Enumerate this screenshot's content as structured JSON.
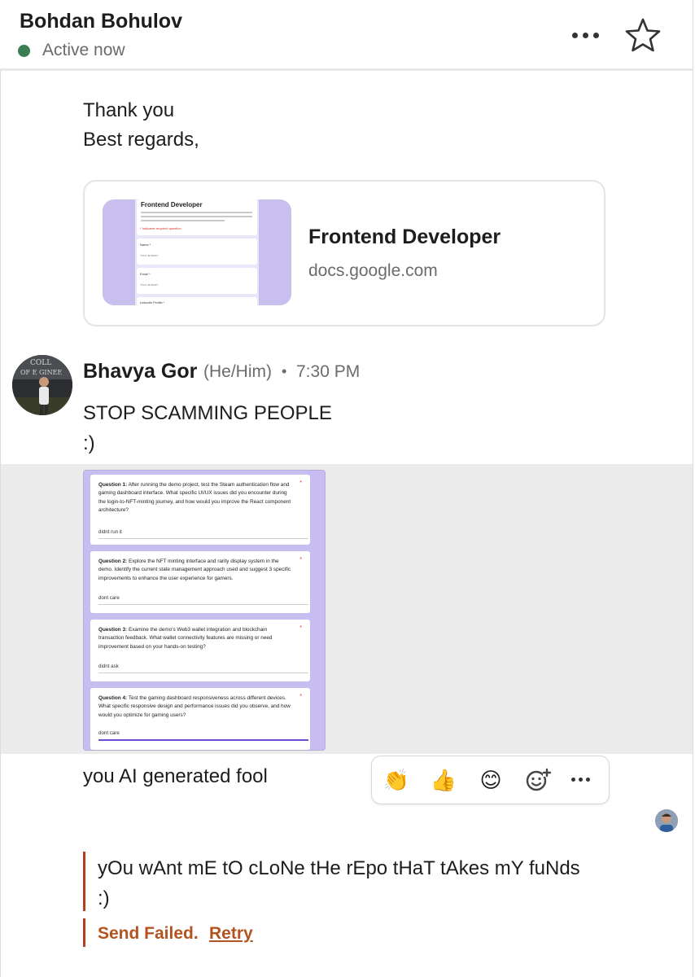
{
  "header": {
    "contact_name": "Bohdan Bohulov",
    "status": "Active now",
    "status_color": "#3d7d55"
  },
  "message1": {
    "lines": [
      "Thank you",
      "Best regards,"
    ]
  },
  "link_preview": {
    "title": "Frontend Developer",
    "domain": "docs.google.com",
    "thumbnail": {
      "form_title": "Frontend Developer",
      "required_note": "* Indicates required question",
      "fields": [
        "Name *",
        "Email *",
        "LinkedIn Profile *"
      ],
      "field_placeholder": "Your answer"
    }
  },
  "message2": {
    "sender": "Bhavya Gor",
    "pronouns": "(He/Him)",
    "separator": "•",
    "time": "7:30 PM",
    "lines": [
      "STOP SCAMMING PEOPLE",
      ":)"
    ]
  },
  "form_image": {
    "questions": [
      {
        "label": "Question 1:",
        "text": "After running the demo project, test the Steam authentication flow and gaming dashboard interface. What specific UI/UX issues did you encounter during the login-to-NFT-minting journey, and how would you improve the React component architecture?",
        "answer": "didnt run it"
      },
      {
        "label": "Question 2:",
        "text": "Explore the NFT minting interface and rarity display system in the demo. Identify the current state management approach used and suggest 3 specific improvements to enhance the user experience for gamers.",
        "answer": "dont care"
      },
      {
        "label": "Question 3:",
        "text": "Examine the demo's Web3 wallet integration and blockchain transaction feedback. What wallet connectivity features are missing or need improvement based on your hands-on testing?",
        "answer": "didnt ask"
      },
      {
        "label": "Question 4:",
        "text": "Test the gaming dashboard responsiveness across different devices. What specific responsive design and performance issues did you observe, and how would you optimize for gaming users?",
        "answer": "dont care"
      }
    ],
    "required_mark": "*"
  },
  "message3": {
    "text": "you AI generated fool"
  },
  "reactions": {
    "items": [
      {
        "icon": "clapping-hands-icon",
        "glyph": "👏"
      },
      {
        "icon": "thumbs-up-icon",
        "glyph": "👍"
      },
      {
        "icon": "smiling-face-icon",
        "glyph": "😊"
      },
      {
        "icon": "add-reaction-icon",
        "glyph": ""
      }
    ]
  },
  "failed_message": {
    "text": "yOu wAnt mE tO cLoNe tHe rEpo tHaT tAkes mY fuNds :)",
    "status": "Send Failed.",
    "retry": "Retry",
    "accent_color": "#b35420"
  }
}
